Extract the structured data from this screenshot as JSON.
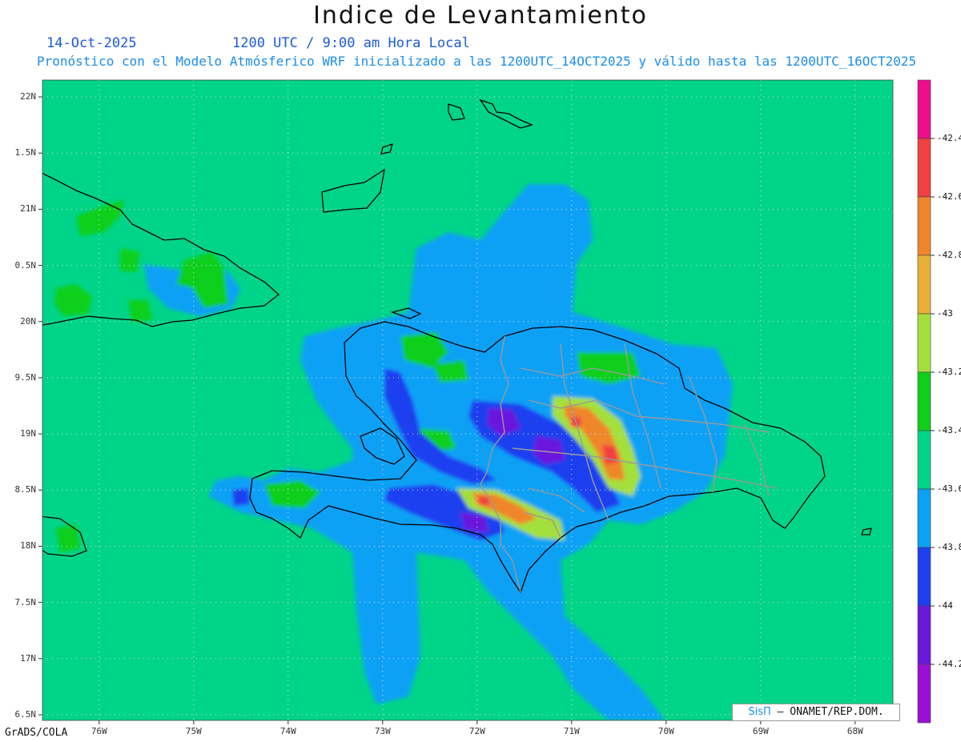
{
  "header": {
    "title": "Indice de Levantamiento",
    "date": "14-Oct-2025",
    "time": "1200 UTC / 9:00 am Hora Local",
    "forecast": "Pronóstico con el Modelo Atmósferico WRF inicializado a las 1200UTC_14OCT2025 y válido hasta las  1200UTC_16OCT2025"
  },
  "axes": {
    "lat_labels": [
      "22N",
      "1.5N",
      "21N",
      "0.5N",
      "20N",
      "9.5N",
      "19N",
      "8.5N",
      "18N",
      "7.5N",
      "17N",
      "6.5N"
    ],
    "lat_values": [
      22,
      21.5,
      21,
      20.5,
      20,
      19.5,
      19,
      18.5,
      18,
      17.5,
      17,
      16.5
    ],
    "lon_labels": [
      "76W",
      "75W",
      "74W",
      "73W",
      "72W",
      "71W",
      "70W",
      "69W",
      "68W"
    ],
    "lon_values": [
      -76,
      -75,
      -74,
      -73,
      -72,
      -71,
      -70,
      -69,
      -68
    ]
  },
  "colorbar": {
    "labels": [
      "-42.4",
      "-42.6",
      "-42.8",
      "-43",
      "-43.2",
      "-43.4",
      "-43.6",
      "-43.8",
      "-44",
      "-44.2"
    ],
    "colors": [
      "#ee0d8e",
      "#f23f3f",
      "#f0862c",
      "#e8b038",
      "#a3e03a",
      "#0fcf1b",
      "#00d488",
      "#0aa1f6",
      "#1f3ff0",
      "#6b18dc",
      "#9a0fd4"
    ]
  },
  "footer": {
    "software": "GrADS/COLA",
    "credit_logo": "SisΠ",
    "credit_org": "– ONAMET/REP.DOM."
  },
  "colors": {
    "background_field": "#00d488",
    "land_outline": "#000000",
    "province_lines": "#9a9a9a"
  }
}
